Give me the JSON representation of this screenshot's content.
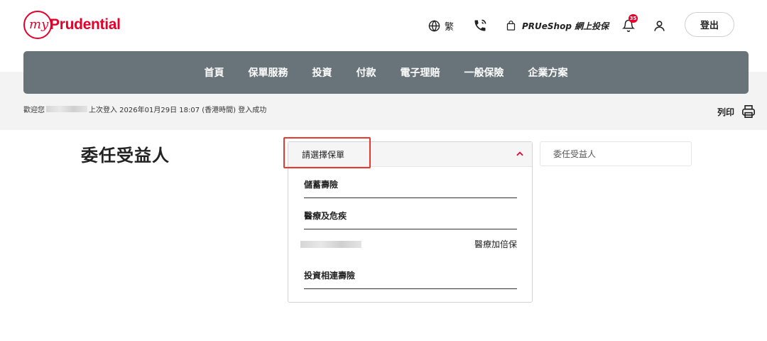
{
  "brand": {
    "my": "my",
    "name": "Prudential",
    "color": "#e4002b"
  },
  "header": {
    "language_label": "繁",
    "shop_label": "PRUeShop 網上投保",
    "notification_count": "35",
    "logout_label": "登出"
  },
  "nav": {
    "items": [
      {
        "label": "首頁"
      },
      {
        "label": "保單服務"
      },
      {
        "label": "投資"
      },
      {
        "label": "付款"
      },
      {
        "label": "電子理賠"
      },
      {
        "label": "一般保險"
      },
      {
        "label": "企業方案"
      }
    ],
    "background": "#68737a"
  },
  "welcome": {
    "prefix": "歡迎您",
    "message": "上次登入 2026年01月29日 18:07 (香港時間) 登入成功"
  },
  "print_label": "列印",
  "page_title": "委任受益人",
  "policy_select": {
    "placeholder": "請選擇保單",
    "groups": [
      {
        "label": "儲蓄壽險"
      },
      {
        "label": "醫療及危疾"
      },
      {
        "label": "投資相連壽險"
      }
    ],
    "option": {
      "product": "醫療加倍保"
    }
  },
  "beneficiary_field": {
    "label": "委任受益人"
  },
  "icons": {
    "language": "globe-icon",
    "phone": "phone-icon",
    "shop": "shopping-bag-icon",
    "notifications": "bell-icon",
    "user": "user-icon",
    "print": "printer-icon",
    "dropdown": "chevron-up-icon"
  },
  "colors": {
    "accent": "#e4002b",
    "highlight_box": "#e8392e"
  }
}
